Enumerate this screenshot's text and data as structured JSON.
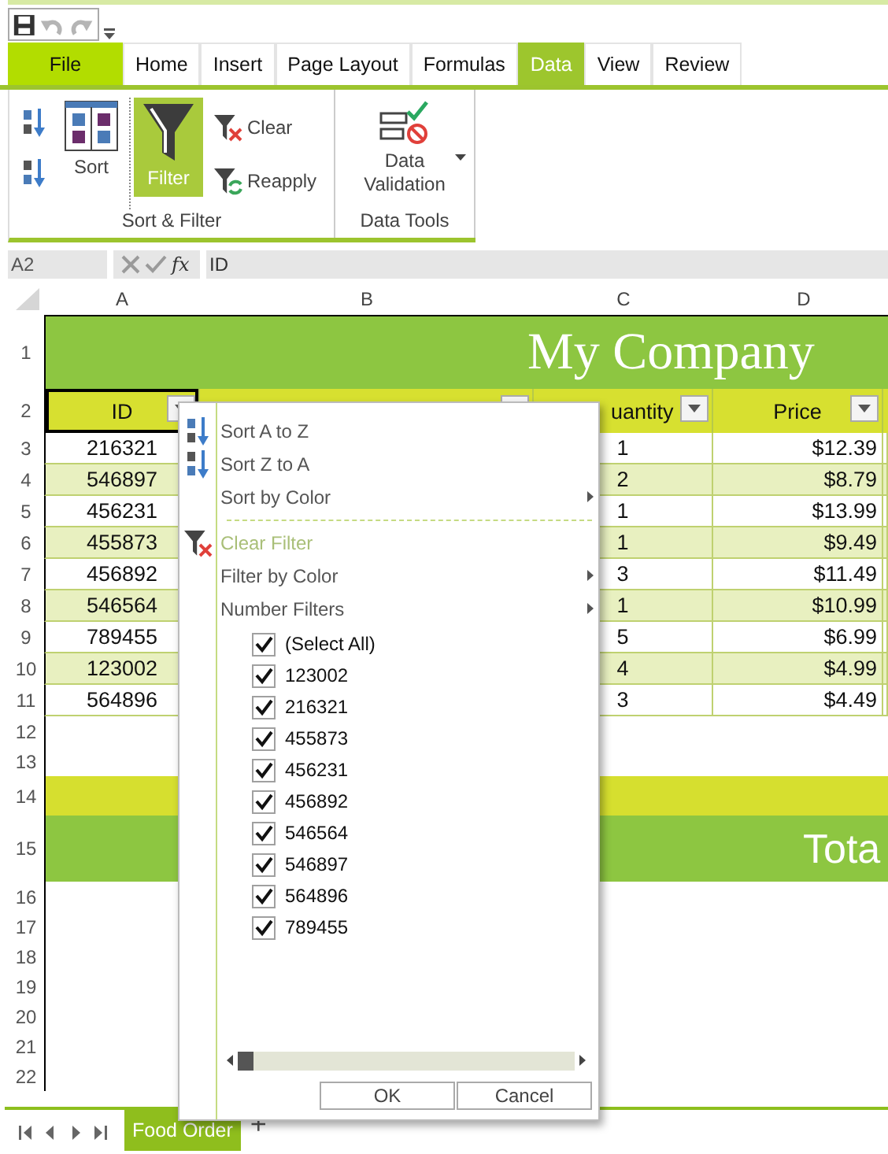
{
  "quick_access": [
    {
      "kind": "save",
      "disabled": false
    },
    {
      "kind": "undo",
      "disabled": true
    },
    {
      "kind": "redo",
      "disabled": true
    }
  ],
  "tabs": [
    {
      "label": "File",
      "kind": "file",
      "selected": false
    },
    {
      "label": "Home",
      "kind": "tab",
      "selected": false
    },
    {
      "label": "Insert",
      "kind": "tab",
      "selected": false
    },
    {
      "label": "Page Layout",
      "kind": "tab",
      "selected": false
    },
    {
      "label": "Formulas",
      "kind": "tab",
      "selected": false
    },
    {
      "label": "Data",
      "kind": "tab",
      "selected": true
    },
    {
      "label": "View",
      "kind": "tab",
      "selected": false
    },
    {
      "label": "Review",
      "kind": "tab",
      "selected": false
    }
  ],
  "ribbon": {
    "groups": [
      {
        "label": "Sort & Filter",
        "columns": [
          [
            {
              "kind": "sort-asc"
            },
            {
              "kind": "sort-desc"
            }
          ],
          [
            {
              "kind": "sort",
              "label": "Sort"
            }
          ],
          [
            {
              "kind": "filter",
              "label": "Filter",
              "on": true
            }
          ],
          [
            {
              "kind": "clear",
              "label": "Clear"
            },
            {
              "kind": "reapply",
              "label": "Reapply"
            }
          ]
        ]
      },
      {
        "label": "Data Tools",
        "columns": [
          [
            {
              "kind": "data-validation",
              "label": "Data Validation",
              "dropdown": true
            }
          ]
        ]
      }
    ]
  },
  "formula_bar": {
    "name_box": "A2",
    "function_label": "fx",
    "formula": "ID"
  },
  "sheet": {
    "columns": [
      "A",
      "B",
      "C",
      "D"
    ],
    "rows": [
      {
        "number": "1",
        "kind": "title",
        "text": "My Company"
      },
      {
        "number": "2",
        "kind": "header",
        "cells": [
          {
            "text": "ID",
            "filter": true,
            "selected": true
          },
          {
            "filter": true,
            "selected": false
          },
          {
            "text": "uantity",
            "filter": true,
            "selected": false
          },
          {
            "text": "Price",
            "filter": true,
            "selected": false
          }
        ]
      },
      {
        "number": "3",
        "kind": "data",
        "id": "216321",
        "quantity": "1",
        "price": "$12.39"
      },
      {
        "number": "4",
        "kind": "data",
        "id": "546897",
        "quantity": "2",
        "price": "$8.79"
      },
      {
        "number": "5",
        "kind": "data",
        "id": "456231",
        "quantity": "1",
        "price": "$13.99"
      },
      {
        "number": "6",
        "kind": "data",
        "id": "455873",
        "quantity": "1",
        "price": "$9.49"
      },
      {
        "number": "7",
        "kind": "data",
        "id": "456892",
        "quantity": "3",
        "price": "$11.49"
      },
      {
        "number": "8",
        "kind": "data",
        "id": "546564",
        "quantity": "1",
        "price": "$10.99"
      },
      {
        "number": "9",
        "kind": "data",
        "id": "789455",
        "quantity": "5",
        "price": "$6.99"
      },
      {
        "number": "10",
        "kind": "data",
        "id": "123002",
        "quantity": "4",
        "price": "$4.99"
      },
      {
        "number": "11",
        "kind": "data",
        "id": "564896",
        "quantity": "3",
        "price": "$4.49"
      },
      {
        "number": "12",
        "kind": "blank"
      },
      {
        "number": "13",
        "kind": "blank"
      },
      {
        "number": "14",
        "kind": "band"
      },
      {
        "number": "15",
        "kind": "total",
        "text": "Tota"
      },
      {
        "number": "16",
        "kind": "blank"
      },
      {
        "number": "17",
        "kind": "blank"
      },
      {
        "number": "18",
        "kind": "blank"
      },
      {
        "number": "19",
        "kind": "blank"
      },
      {
        "number": "20",
        "kind": "blank"
      },
      {
        "number": "21",
        "kind": "blank"
      },
      {
        "number": "22",
        "kind": "blank"
      }
    ]
  },
  "filter_menu": {
    "items": [
      {
        "label": "Sort A to Z",
        "kind": "sort-asc",
        "disabled": false,
        "submenu": false
      },
      {
        "label": "Sort Z to A",
        "kind": "sort-desc",
        "disabled": false,
        "submenu": false
      },
      {
        "label": "Sort by Color",
        "kind": "plain",
        "disabled": false,
        "submenu": true
      },
      {
        "kind": "separator"
      },
      {
        "label": "Clear Filter",
        "kind": "clear",
        "disabled": true,
        "submenu": false
      },
      {
        "label": "Filter by Color",
        "kind": "plain",
        "disabled": false,
        "submenu": true
      },
      {
        "label": "Number Filters",
        "kind": "plain",
        "disabled": false,
        "submenu": true
      }
    ],
    "values": [
      {
        "label": "(Select All)",
        "checked": true
      },
      {
        "label": "123002",
        "checked": true
      },
      {
        "label": "216321",
        "checked": true
      },
      {
        "label": "455873",
        "checked": true
      },
      {
        "label": "456231",
        "checked": true
      },
      {
        "label": "456892",
        "checked": true
      },
      {
        "label": "546564",
        "checked": true
      },
      {
        "label": "546897",
        "checked": true
      },
      {
        "label": "564896",
        "checked": true
      },
      {
        "label": "789455",
        "checked": true
      }
    ],
    "buttons": [
      "OK",
      "Cancel"
    ]
  },
  "sheet_tabs": {
    "tabs": [
      {
        "label": "Food Order",
        "selected": true
      }
    ],
    "add_tab": "+"
  }
}
